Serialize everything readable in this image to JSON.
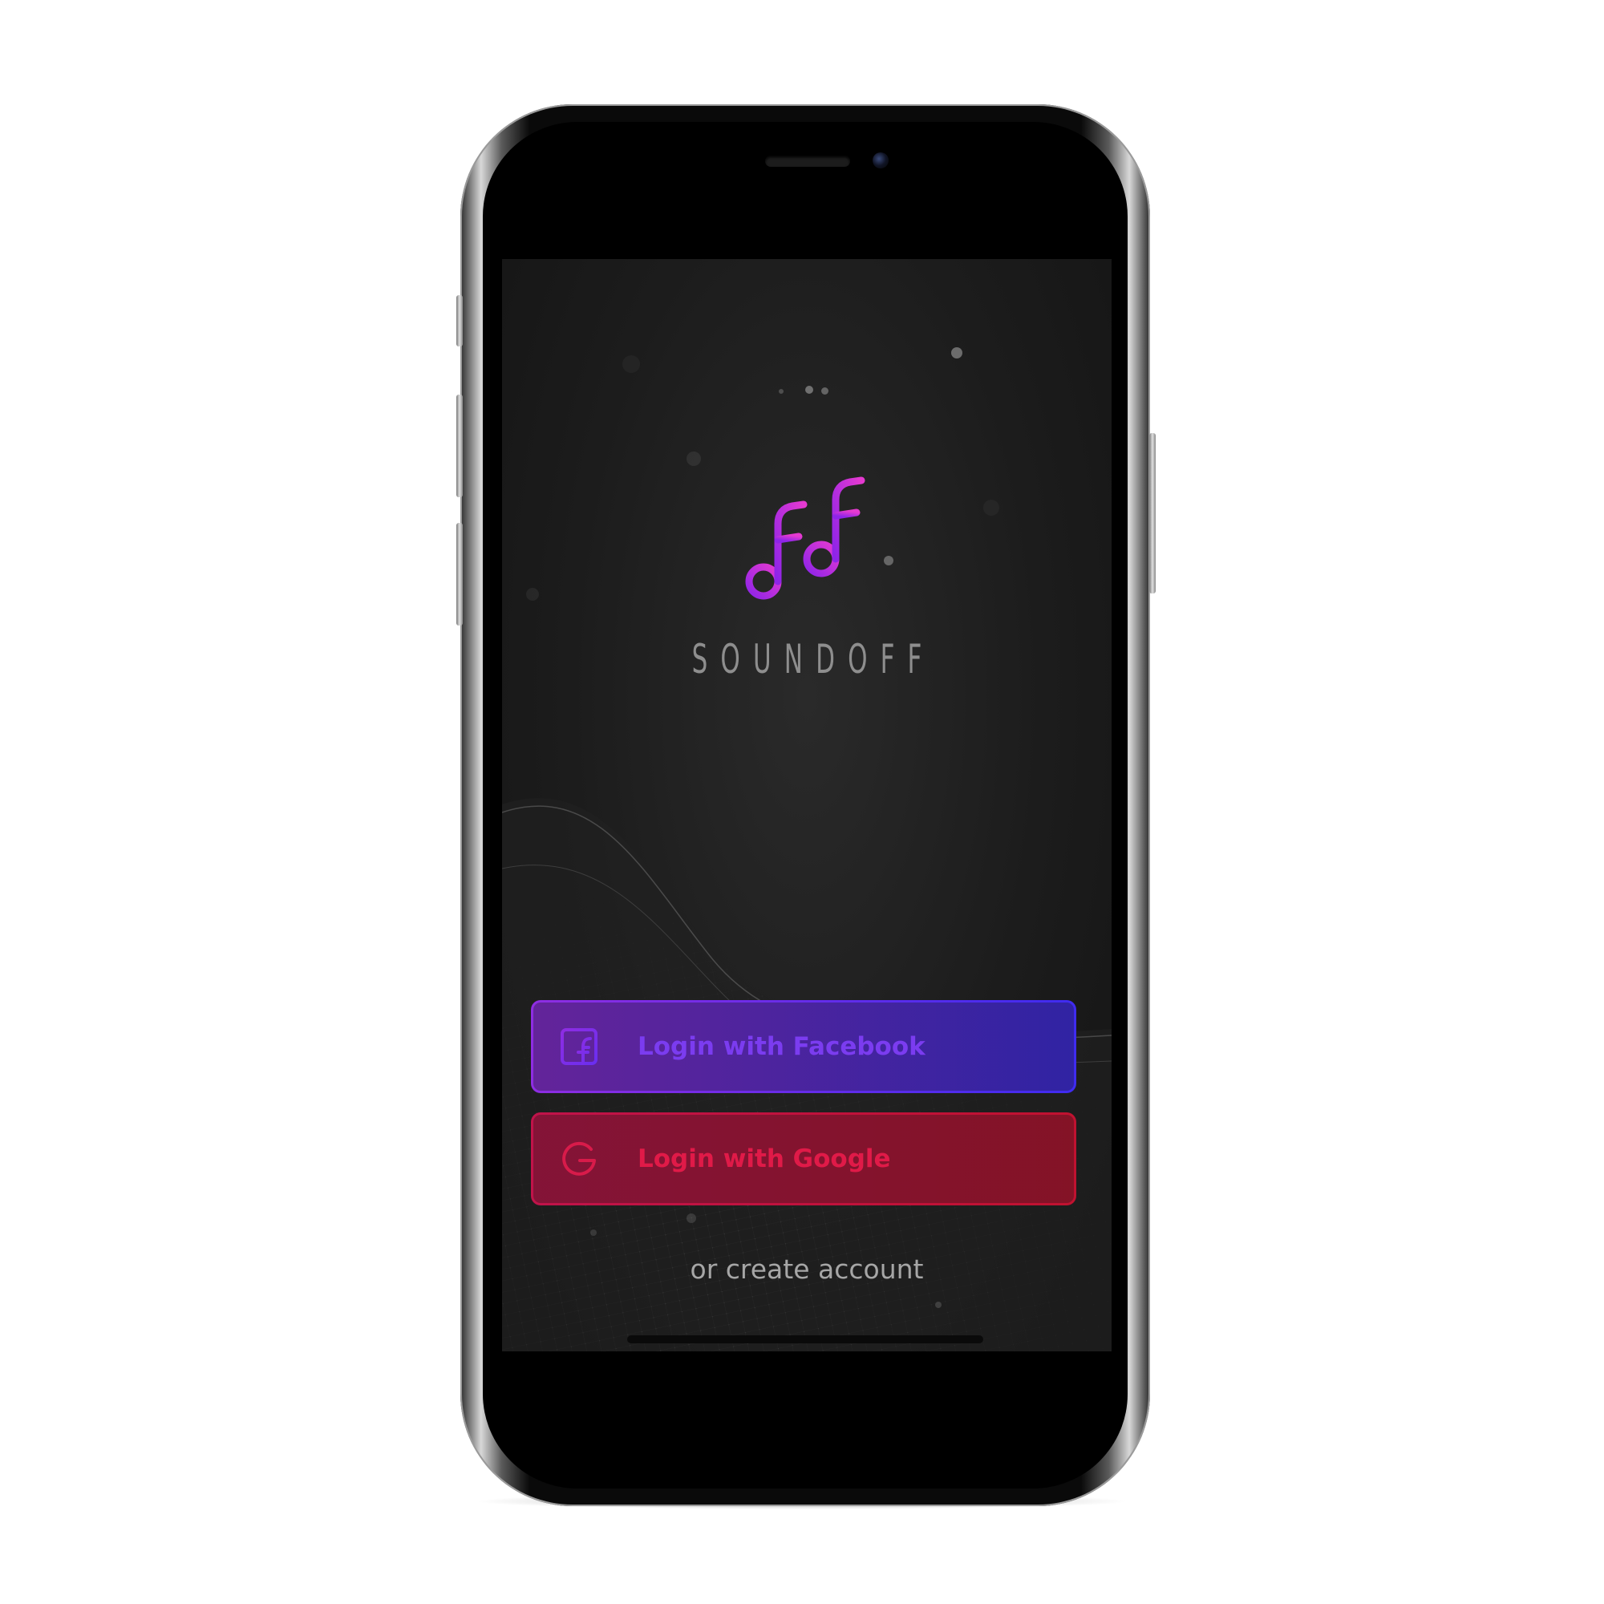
{
  "app": {
    "brand_name": "SOUNDOFF",
    "logo_icon": "double-music-note-icon"
  },
  "login": {
    "facebook_label": "Login with Facebook",
    "facebook_icon": "facebook-icon",
    "google_label": "Login with Google",
    "google_icon": "google-icon",
    "create_account_label": "or create account"
  },
  "colors": {
    "background": "#1c1c1c",
    "brand_text": "#8e8e8e",
    "facebook_gradient_start": "#8e2de2",
    "facebook_gradient_end": "#3f2bf0",
    "google_accent": "#e01a48",
    "create_account_text": "#a6a6a6"
  }
}
